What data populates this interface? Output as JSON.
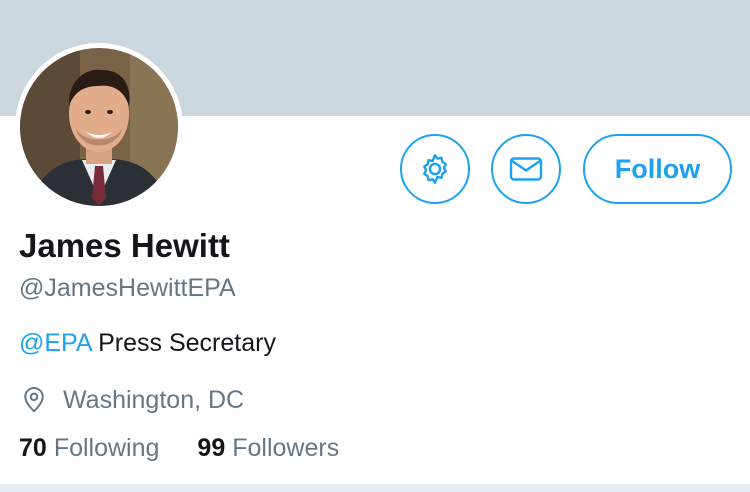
{
  "profile": {
    "name": "James Hewitt",
    "handle": "@JamesHewittEPA",
    "bio_mention": "@EPA",
    "bio_text": " Press Secretary",
    "location": "Washington, DC"
  },
  "actions": {
    "settings_icon": "gear-icon",
    "message_icon": "envelope-icon",
    "follow_label": "Follow"
  },
  "stats": {
    "following_count": "70",
    "following_label": "Following",
    "followers_count": "99",
    "followers_label": "Followers"
  },
  "colors": {
    "accent": "#1da1f2",
    "banner": "#ccd6dd",
    "text_primary": "#14171a",
    "text_secondary": "#657786"
  }
}
